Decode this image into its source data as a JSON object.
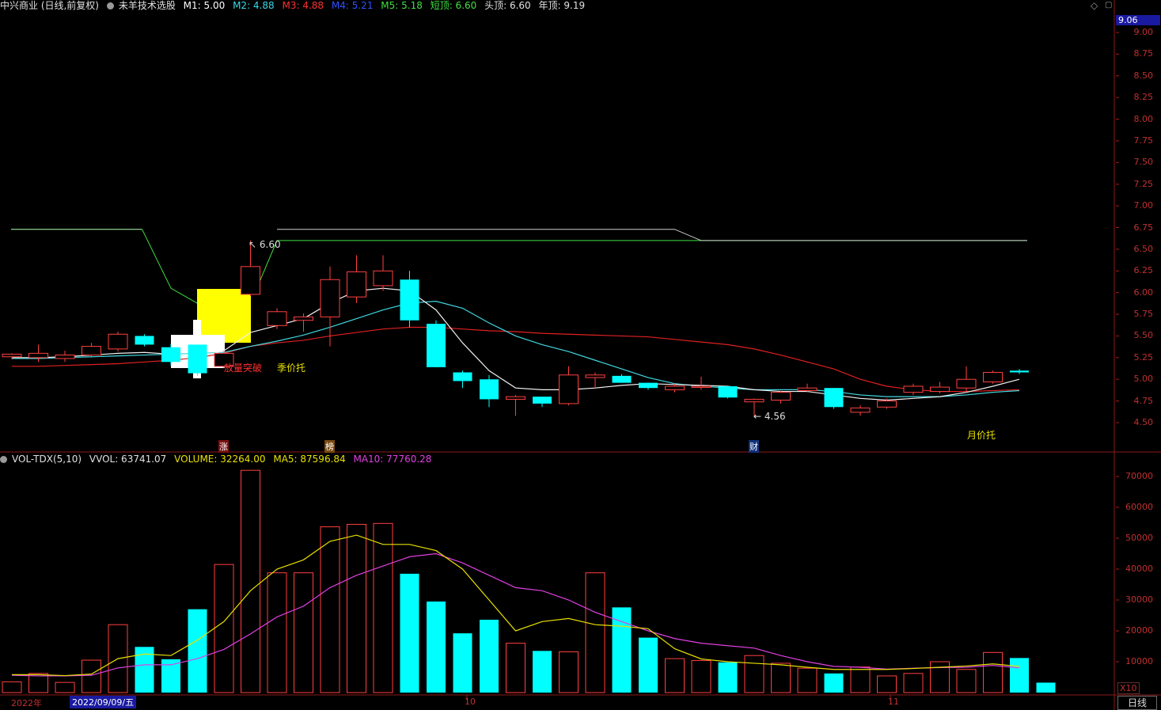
{
  "header": {
    "stock": "中兴商业 (日线,前复权)",
    "indicator": "未羊技术选股",
    "m1": "M1: 5.00",
    "m2": "M2: 4.88",
    "m3": "M3: 4.88",
    "m4": "M4: 5.21",
    "m5": "M5: 5.18",
    "short_top": "短顶: 6.60",
    "head_top": "头顶: 6.60",
    "year_top": "年顶: 9.19",
    "right_price": "9.06",
    "colors": {
      "m1": "#ffffff",
      "m2": "#38d8e8",
      "m3": "#ff3030",
      "m4": "#3050ff",
      "m5": "#40e040",
      "text": "#e0e0e0"
    }
  },
  "price_axis": [
    "9.00",
    "8.75",
    "8.50",
    "8.25",
    "8.00",
    "7.75",
    "7.50",
    "7.25",
    "7.00",
    "6.75",
    "6.50",
    "6.25",
    "6.00",
    "5.75",
    "5.50",
    "5.25",
    "5.00",
    "4.75",
    "4.50"
  ],
  "volume_axis": [
    "70000",
    "60000",
    "50000",
    "40000",
    "30000",
    "20000",
    "10000"
  ],
  "volume_header": {
    "name": "VOL-TDX(5,10)",
    "vvol": "VVOL: 63741.07",
    "volume": "VOLUME: 32264.00",
    "ma5": "MA5: 87596.84",
    "ma10": "MA10: 77760.28",
    "multiplier": "X10"
  },
  "annotations": {
    "high": "6.60",
    "low": "4.56",
    "breakout": "放量突破",
    "season_support": "季价托",
    "month_support": "月价托",
    "mark_zhang": "涨",
    "mark_bang": "榜",
    "mark_cai": "财"
  },
  "time_axis": {
    "year": "2022年",
    "selected_date": "2022/09/09/五",
    "oct": "10",
    "nov": "11",
    "period_button": "日线"
  },
  "chart_data": {
    "type": "candlestick",
    "price_range": [
      4.3,
      9.06
    ],
    "volume_range": [
      0,
      73000
    ],
    "candles": [
      {
        "o": 5.26,
        "h": 5.3,
        "l": 5.23,
        "c": 5.29
      },
      {
        "o": 5.25,
        "h": 5.4,
        "l": 5.2,
        "c": 5.3
      },
      {
        "o": 5.24,
        "h": 5.33,
        "l": 5.2,
        "c": 5.28
      },
      {
        "o": 5.28,
        "h": 5.42,
        "l": 5.25,
        "c": 5.38
      },
      {
        "o": 5.35,
        "h": 5.55,
        "l": 5.32,
        "c": 5.52
      },
      {
        "o": 5.5,
        "h": 5.52,
        "l": 5.38,
        "c": 5.4
      },
      {
        "o": 5.37,
        "h": 5.41,
        "l": 5.16,
        "c": 5.2
      },
      {
        "o": 5.4,
        "h": 5.4,
        "l": 5.04,
        "c": 5.07
      },
      {
        "o": 5.15,
        "h": 5.33,
        "l": 5.13,
        "c": 5.3
      },
      {
        "o": 5.98,
        "h": 6.6,
        "l": 5.96,
        "c": 6.3
      },
      {
        "o": 5.62,
        "h": 5.82,
        "l": 5.58,
        "c": 5.78
      },
      {
        "o": 5.68,
        "h": 5.76,
        "l": 5.55,
        "c": 5.72
      },
      {
        "o": 5.72,
        "h": 6.3,
        "l": 5.38,
        "c": 6.15
      },
      {
        "o": 5.95,
        "h": 6.43,
        "l": 5.88,
        "c": 6.24
      },
      {
        "o": 6.08,
        "h": 6.43,
        "l": 6.02,
        "c": 6.25
      },
      {
        "o": 6.15,
        "h": 6.25,
        "l": 5.6,
        "c": 5.68
      },
      {
        "o": 5.64,
        "h": 5.68,
        "l": 5.14,
        "c": 5.14
      },
      {
        "o": 5.08,
        "h": 5.1,
        "l": 4.9,
        "c": 4.98
      },
      {
        "o": 5.0,
        "h": 5.05,
        "l": 4.68,
        "c": 4.77
      },
      {
        "o": 4.77,
        "h": 4.82,
        "l": 4.58,
        "c": 4.8
      },
      {
        "o": 4.8,
        "h": 4.8,
        "l": 4.68,
        "c": 4.72
      },
      {
        "o": 4.72,
        "h": 5.15,
        "l": 4.7,
        "c": 5.05
      },
      {
        "o": 5.02,
        "h": 5.08,
        "l": 4.9,
        "c": 5.05
      },
      {
        "o": 5.04,
        "h": 5.06,
        "l": 4.96,
        "c": 4.96
      },
      {
        "o": 4.96,
        "h": 4.96,
        "l": 4.88,
        "c": 4.9
      },
      {
        "o": 4.88,
        "h": 4.95,
        "l": 4.85,
        "c": 4.92
      },
      {
        "o": 4.92,
        "h": 5.03,
        "l": 4.88,
        "c": 4.92
      },
      {
        "o": 4.92,
        "h": 4.92,
        "l": 4.78,
        "c": 4.79
      },
      {
        "o": 4.74,
        "h": 4.78,
        "l": 4.56,
        "c": 4.77
      },
      {
        "o": 4.76,
        "h": 4.87,
        "l": 4.72,
        "c": 4.85
      },
      {
        "o": 4.87,
        "h": 4.95,
        "l": 4.85,
        "c": 4.9
      },
      {
        "o": 4.9,
        "h": 4.9,
        "l": 4.66,
        "c": 4.68
      },
      {
        "o": 4.62,
        "h": 4.7,
        "l": 4.58,
        "c": 4.67
      },
      {
        "o": 4.68,
        "h": 4.78,
        "l": 4.66,
        "c": 4.75
      },
      {
        "o": 4.85,
        "h": 4.95,
        "l": 4.82,
        "c": 4.92
      },
      {
        "o": 4.86,
        "h": 4.97,
        "l": 4.84,
        "c": 4.91
      },
      {
        "o": 4.9,
        "h": 5.15,
        "l": 4.85,
        "c": 5.0
      },
      {
        "o": 4.97,
        "h": 5.1,
        "l": 4.95,
        "c": 5.08
      },
      {
        "o": 5.1,
        "h": 5.12,
        "l": 5.06,
        "c": 5.08
      }
    ],
    "volume": [
      3500,
      6200,
      3300,
      10500,
      22000,
      14800,
      10800,
      27000,
      41500,
      72000,
      38800,
      38800,
      53700,
      54500,
      54800,
      38500,
      29500,
      19200,
      23600,
      16000,
      13500,
      13200,
      38800,
      27600,
      17800,
      11000,
      10400,
      9800,
      12000,
      9500,
      7900,
      6200,
      8300,
      5400,
      6200,
      10000,
      7500,
      13000,
      11200,
      3226
    ],
    "ma_white": [
      5.25,
      5.25,
      5.26,
      5.28,
      5.3,
      5.31,
      5.29,
      5.25,
      5.33,
      5.54,
      5.62,
      5.7,
      5.88,
      6.02,
      6.05,
      6.02,
      5.8,
      5.42,
      5.1,
      4.9,
      4.88,
      4.88,
      4.9,
      4.93,
      4.95,
      4.94,
      4.93,
      4.92,
      4.88,
      4.86,
      4.86,
      4.82,
      4.78,
      4.76,
      4.78,
      4.8,
      4.85,
      4.92,
      5.0
    ],
    "ma_cyan": [
      5.24,
      5.24,
      5.25,
      5.26,
      5.27,
      5.28,
      5.29,
      5.3,
      5.31,
      5.38,
      5.44,
      5.51,
      5.6,
      5.7,
      5.8,
      5.88,
      5.9,
      5.82,
      5.65,
      5.5,
      5.4,
      5.32,
      5.22,
      5.12,
      5.02,
      4.95,
      4.92,
      4.9,
      4.88,
      4.88,
      4.88,
      4.86,
      4.82,
      4.8,
      4.8,
      4.8,
      4.82,
      4.85,
      4.87
    ],
    "ma_red": [
      5.15,
      5.15,
      5.16,
      5.17,
      5.18,
      5.2,
      5.22,
      5.25,
      5.3,
      5.38,
      5.42,
      5.45,
      5.5,
      5.54,
      5.58,
      5.6,
      5.6,
      5.58,
      5.56,
      5.55,
      5.53,
      5.52,
      5.51,
      5.5,
      5.49,
      5.46,
      5.43,
      5.4,
      5.35,
      5.28,
      5.2,
      5.12,
      5.0,
      4.92,
      4.88,
      4.86,
      4.86,
      4.87,
      4.88
    ],
    "vol_ma5": [
      5800,
      5800,
      5500,
      6000,
      11000,
      12500,
      12000,
      17000,
      23000,
      33000,
      40000,
      43000,
      49000,
      51000,
      48000,
      48000,
      46000,
      40000,
      30000,
      20000,
      23000,
      24000,
      22000,
      21500,
      20700,
      14200,
      10900,
      10000,
      9500,
      9000,
      8200,
      7500,
      7500,
      7500,
      7800,
      8200,
      8600,
      9300,
      8500
    ],
    "vol_ma10": [
      5600,
      5400,
      5400,
      5600,
      8000,
      9000,
      9000,
      11000,
      14000,
      19000,
      24500,
      28000,
      34000,
      38000,
      41000,
      44000,
      45000,
      42000,
      38000,
      34000,
      33000,
      30000,
      26000,
      23000,
      20000,
      17500,
      16000,
      15200,
      14400,
      12000,
      10000,
      8500,
      8200,
      7600,
      7900,
      8100,
      8200,
      8800,
      8000
    ]
  }
}
